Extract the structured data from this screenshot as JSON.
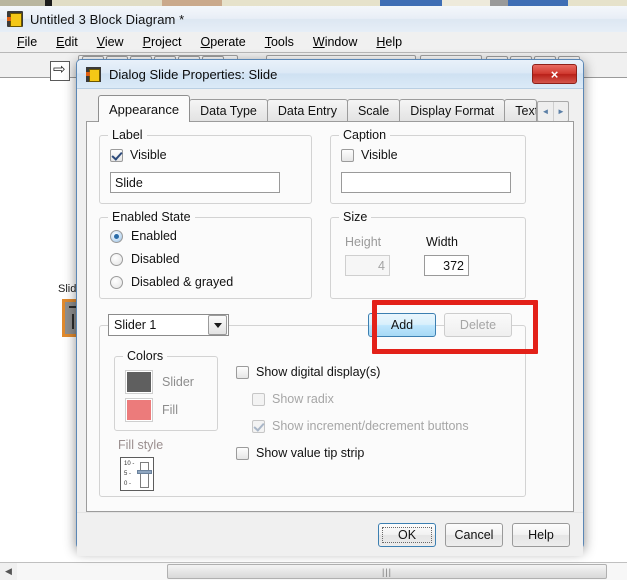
{
  "main_window": {
    "title": "Untitled 3 Block Diagram *",
    "icon": "labview-icon",
    "menus": [
      {
        "label": "File",
        "mnemonic": "F"
      },
      {
        "label": "Edit",
        "mnemonic": "E"
      },
      {
        "label": "View",
        "mnemonic": "V"
      },
      {
        "label": "Project",
        "mnemonic": "P"
      },
      {
        "label": "Operate",
        "mnemonic": "O"
      },
      {
        "label": "Tools",
        "mnemonic": "T"
      },
      {
        "label": "Window",
        "mnemonic": "W"
      },
      {
        "label": "Help",
        "mnemonic": "H"
      }
    ],
    "diagram": {
      "terminal_label": "Slide"
    }
  },
  "dialog": {
    "title": "Dialog Slide Properties: Slide",
    "icon": "labview-icon",
    "close_label": "×",
    "tabs": [
      {
        "label": "Appearance",
        "active": true
      },
      {
        "label": "Data Type",
        "active": false
      },
      {
        "label": "Data Entry",
        "active": false
      },
      {
        "label": "Scale",
        "active": false
      },
      {
        "label": "Display Format",
        "active": false
      },
      {
        "label": "Text Label",
        "active": false
      }
    ],
    "tab_scroll": {
      "prev": "◄",
      "next": "►"
    },
    "appearance": {
      "label_group": {
        "title": "Label",
        "visible_label": "Visible",
        "visible_checked": true,
        "text_value": "Slide"
      },
      "caption_group": {
        "title": "Caption",
        "visible_label": "Visible",
        "visible_checked": false,
        "text_value": ""
      },
      "enabled_state_group": {
        "title": "Enabled State",
        "options": [
          {
            "label": "Enabled",
            "selected": true
          },
          {
            "label": "Disabled",
            "selected": false
          },
          {
            "label": "Disabled & grayed",
            "selected": false
          }
        ]
      },
      "size_group": {
        "title": "Size",
        "height_label": "Height",
        "height_value": "4",
        "height_disabled": true,
        "width_label": "Width",
        "width_value": "372",
        "width_disabled": false
      },
      "slider_section": {
        "selector_value": "Slider 1",
        "add_label": "Add",
        "add_state": "highlighted",
        "delete_label": "Delete",
        "delete_disabled": true,
        "colors_group": {
          "title": "Colors",
          "items": [
            {
              "label": "Slider",
              "color": "#5f5f5f"
            },
            {
              "label": "Fill",
              "color": "#ec7b7b"
            }
          ]
        },
        "fill_style": {
          "label": "Fill style",
          "ticks": [
            "10 -",
            "5 -",
            "0 -"
          ]
        },
        "checkboxes": [
          {
            "label": "Show digital display(s)",
            "checked": false,
            "disabled": false,
            "indent": 0
          },
          {
            "label": "Show radix",
            "checked": false,
            "disabled": true,
            "indent": 1
          },
          {
            "label": "Show increment/decrement buttons",
            "checked": true,
            "disabled": true,
            "indent": 1
          },
          {
            "label": "Show value tip strip",
            "checked": false,
            "disabled": false,
            "indent": 0
          }
        ]
      }
    },
    "footer": {
      "ok_label": "OK",
      "cancel_label": "Cancel",
      "help_label": "Help"
    }
  },
  "annotation": {
    "color": "#e32119",
    "description": "red-highlight-rectangle"
  }
}
